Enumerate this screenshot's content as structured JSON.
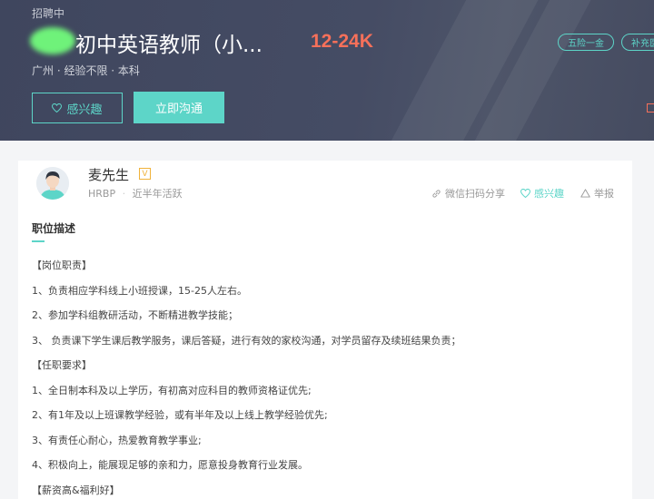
{
  "header": {
    "status": "招聘中",
    "title": "初中英语教师（小...",
    "salary": "12-24K",
    "meta": "广州 · 经验不限 · 本科",
    "interest_label": "感兴趣",
    "chat_label": "立即沟通",
    "tags": [
      "五险一金",
      "补充医"
    ]
  },
  "recruiter": {
    "name": "麦先生",
    "badge": "V",
    "role": "HRBP",
    "activity": "近半年活跃",
    "actions": {
      "share": "微信扫码分享",
      "interest": "感兴趣",
      "report": "举报"
    }
  },
  "description": {
    "heading": "职位描述",
    "lines": [
      "【岗位职责】",
      "1、负责相应学科线上小班授课，15-25人左右。",
      "2、参加学科组教研活动，不断精进教学技能；",
      "3、 负责课下学生课后教学服务，课后答疑，进行有效的家校沟通，对学员留存及续班结果负责；",
      "【任职要求】",
      "1、全日制本科及以上学历，有初高对应科目的教师资格证优先;",
      "2、有1年及以上班课教学经验，或有半年及以上线上教学经验优先;",
      "3、有责任心耐心，热爱教育教学事业;",
      "4、积极向上，能展现足够的亲和力，愿意投身教育行业发展。",
      "【薪资高&福利好】"
    ]
  },
  "colors": {
    "accent": "#5dd5c8",
    "salary": "#f6705a",
    "banner": "#434a61"
  }
}
